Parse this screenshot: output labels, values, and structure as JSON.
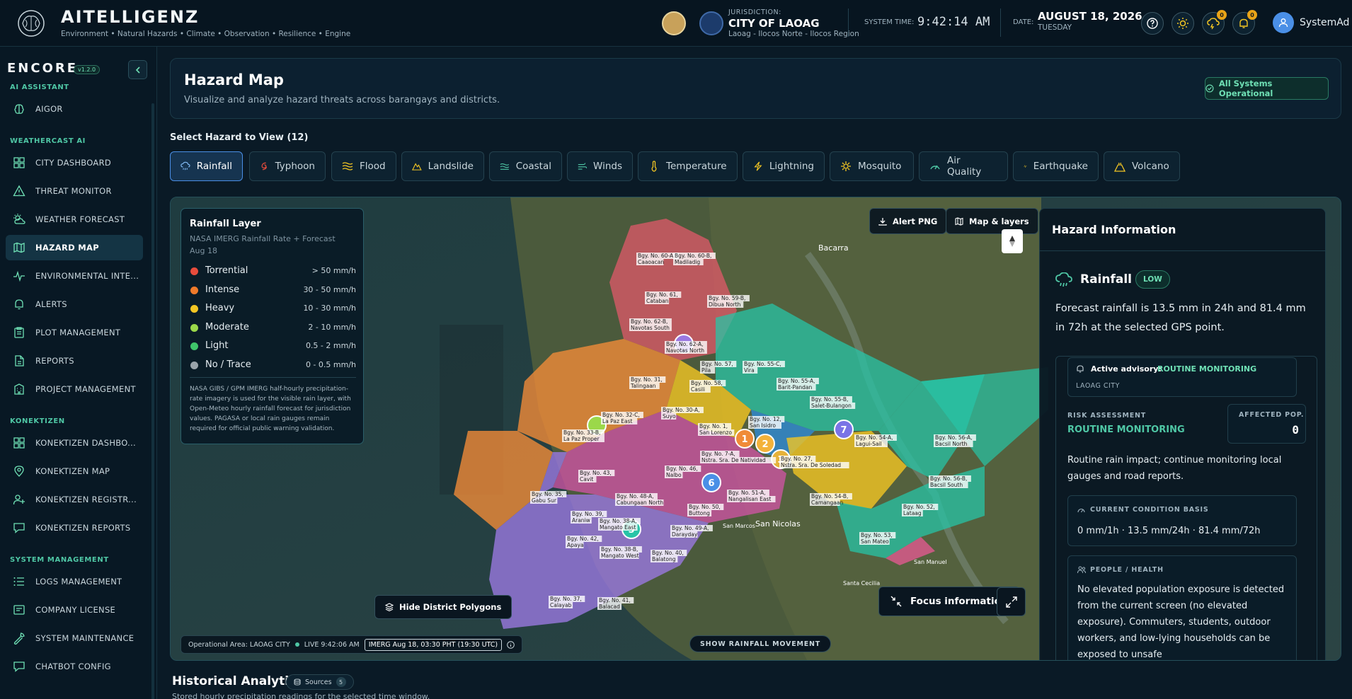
{
  "brand": {
    "name": "AITELLIGENZ",
    "subtitle": "Environment • Natural Hazards • Climate • Observation • Resilience • Engine"
  },
  "jurisdiction": {
    "label": "JURISDICTION:",
    "name": "CITY OF LAOAG",
    "region": "Laoag - Ilocos Norte - Ilocos Region"
  },
  "system_time": {
    "label": "SYSTEM TIME:",
    "value": "9:42:14 AM"
  },
  "date": {
    "label": "DATE:",
    "value": "AUGUST 18, 2026",
    "day": "TUESDAY"
  },
  "header_badges": {
    "weather_count": "0",
    "alerts_count": "0"
  },
  "user": {
    "name": "SystemAd"
  },
  "sidebar": {
    "logo": "ENCORE",
    "version": "v1.2.0",
    "sections": [
      {
        "title": "AI ASSISTANT",
        "items": [
          {
            "label": "AIGOR",
            "icon": "brain-icon"
          }
        ]
      },
      {
        "title": "WEATHERCAST AI",
        "items": [
          {
            "label": "CITY DASHBOARD",
            "icon": "dashboard-icon"
          },
          {
            "label": "THREAT MONITOR",
            "icon": "warning-icon"
          },
          {
            "label": "WEATHER FORECAST",
            "icon": "sun-cloud-icon"
          },
          {
            "label": "HAZARD MAP",
            "icon": "map-icon",
            "active": true
          },
          {
            "label": "ENVIRONMENTAL INTE...",
            "icon": "pulse-icon"
          },
          {
            "label": "ALERTS",
            "icon": "bell-icon"
          },
          {
            "label": "PLOT MANAGEMENT",
            "icon": "clipboard-icon"
          },
          {
            "label": "REPORTS",
            "icon": "report-icon"
          },
          {
            "label": "PROJECT MANAGEMENT",
            "icon": "building-icon"
          }
        ]
      },
      {
        "title": "KONEKTIZEN",
        "items": [
          {
            "label": "KONEKTIZEN DASHBO...",
            "icon": "dashboard-icon"
          },
          {
            "label": "KONEKTIZEN MAP",
            "icon": "location-user-icon"
          },
          {
            "label": "KONEKTIZEN REGISTR...",
            "icon": "user-plus-icon"
          },
          {
            "label": "KONEKTIZEN REPORTS",
            "icon": "chat-icon"
          }
        ]
      },
      {
        "title": "SYSTEM MANAGEMENT",
        "items": [
          {
            "label": "LOGS MANAGEMENT",
            "icon": "list-icon"
          },
          {
            "label": "COMPANY LICENSE",
            "icon": "license-icon"
          },
          {
            "label": "SYSTEM MAINTENANCE",
            "icon": "wrench-icon"
          },
          {
            "label": "CHATBOT CONFIG",
            "icon": "chat-icon"
          }
        ]
      }
    ]
  },
  "page": {
    "title": "Hazard Map",
    "subtitle": "Visualize and analyze hazard threats across barangays and districts.",
    "status": "All Systems Operational"
  },
  "hazards": {
    "title": "Select Hazard to View (12)",
    "tabs": [
      {
        "label": "Rainfall",
        "icon": "rain-icon",
        "active": true
      },
      {
        "label": "Typhoon",
        "icon": "typhoon-icon"
      },
      {
        "label": "Flood",
        "icon": "waves-icon"
      },
      {
        "label": "Landslide",
        "icon": "mountain-icon"
      },
      {
        "label": "Coastal",
        "icon": "coastal-icon"
      },
      {
        "label": "Winds",
        "icon": "wind-icon"
      },
      {
        "label": "Temperature",
        "icon": "thermometer-icon"
      },
      {
        "label": "Lightning",
        "icon": "lightning-icon"
      },
      {
        "label": "Mosquito",
        "icon": "mosquito-icon"
      },
      {
        "label": "Air Quality",
        "icon": "gauge-icon"
      },
      {
        "label": "Earthquake",
        "icon": "seismic-icon"
      },
      {
        "label": "Volcano",
        "icon": "volcano-icon"
      }
    ]
  },
  "legend": {
    "title": "Rainfall Layer",
    "subtitle": "NASA IMERG Rainfall Rate + Forecast",
    "date": "Aug 18",
    "rows": [
      {
        "name": "Torrential",
        "range": "> 50 mm/h",
        "color": "#e74c3c"
      },
      {
        "name": "Intense",
        "range": "30 - 50 mm/h",
        "color": "#f07a2a"
      },
      {
        "name": "Heavy",
        "range": "10 - 30 mm/h",
        "color": "#f3c623"
      },
      {
        "name": "Moderate",
        "range": "2 - 10 mm/h",
        "color": "#9bd84a"
      },
      {
        "name": "Light",
        "range": "0.5 - 2 mm/h",
        "color": "#3fc56a"
      },
      {
        "name": "No / Trace",
        "range": "0 - 0.5 mm/h",
        "color": "#9aa4ab"
      }
    ],
    "note": "NASA GIBS / GPM IMERG half-hourly precipitation-rate imagery is used for the visible rain layer, with Open-Meteo hourly rainfall forecast for jurisdiction values. PAGASA or local rain gauges remain required for official public warning validation."
  },
  "map": {
    "alert_png": "Alert PNG",
    "layers": "Map & layers",
    "hide_polygons": "Hide District Polygons",
    "focus": "Focus information",
    "show_movement": "SHOW RAINFALL MOVEMENT",
    "operational_area": "Operational Area: LAOAG CITY",
    "live": "LIVE 9:42:06 AM",
    "imerg": "IMERG Aug 18, 03:30 PHT (19:30 UTC)",
    "place_labels": [
      "Bacarra",
      "San Nicolas",
      "San Manuel",
      "Santa Cecilia",
      "San Marcos"
    ],
    "barangays": [
      "Bgy. No. 60-A, Caaoacan",
      "Bgy. No. 60-B, Madiladig",
      "Bgy. No. 61, Cataban",
      "Bgy. No. 59-B, Dibua North",
      "Bgy. No. 62-B, Navotas South",
      "Bgy. No. 62-A, Navotas North",
      "Bgy. No. 57, Pila",
      "Bgy. No. 55-C, Vira",
      "Bgy. No. 55-A, Barit-Pandan",
      "Bgy. No. 31, Talingaan",
      "Bgy. No. 58, Casili",
      "Bgy. No. 55-B, Salet-Bulangon",
      "Bgy. No. 30-A, Suyo",
      "Bgy. No. 32-C, La Paz East",
      "Bgy. No. 33-B, La Paz Proper",
      "Bgy. No. 1, San Lorenzo",
      "Bgy. No. 12, San Isidro",
      "Bgy. No. 54-A, Lagui-Sail",
      "Bgy. No. 56-A, Bacsil North",
      "Bgy. No. 7-A, Nstra. Sra. De Natividad",
      "Bgy. No. 27, Nstra. Sra. De Soledad",
      "Bgy. No. 43, Cavit",
      "Bgy. No. 46, Nalbo",
      "Bgy. No. 56-B, Bacsil South",
      "Bgy. No. 35, Gabu Sur",
      "Bgy. No. 48-A, Cabungaan North",
      "Bgy. No. 51-A, Nangalisan East",
      "Bgy. No. 54-B, Camangaan",
      "Bgy. No. 39, Araniw",
      "Bgy. No. 50, Buttong",
      "Bgy. No. 52, Lataag",
      "Bgy. No. 38-A, Mangato East",
      "Bgy. No. 49-A, Darayday",
      "Bgy. No. 53, San Mateo",
      "Bgy. No. 42, Apaya",
      "Bgy. No. 38-B, Mangato West",
      "Bgy. No. 40, Balatong",
      "Bgy. No. 37, Calayab",
      "Bgy. No. 41, Balacad"
    ]
  },
  "info": {
    "title": "Hazard Information",
    "hazard": "Rainfall",
    "level": "LOW",
    "forecast": "Forecast rainfall is 13.5 mm in 24h and 81.4 mm in 72h at the selected GPS point.",
    "advisory_label": "Active advisory:",
    "advisory_value": "ROUTINE MONITORING",
    "city": "LAOAG CITY",
    "risk_label": "RISK ASSESSMENT",
    "risk_value": "ROUTINE MONITORING",
    "affected_label": "AFFECTED POP.",
    "affected_value": "0",
    "impact": "Routine rain impact; continue monitoring local gauges and road reports.",
    "condition_label": "CURRENT CONDITION BASIS",
    "condition_value": "0 mm/1h · 13.5 mm/24h · 81.4 mm/72h",
    "people_label": "PEOPLE / HEALTH",
    "people_text": "No elevated population exposure is detected from the current screen (no elevated exposure). Commuters, students, outdoor workers, and low-lying households can be exposed to unsafe"
  },
  "historical": {
    "title": "Historical Analytics",
    "sources_label": "Sources",
    "sources_count": "5",
    "subtitle": "Stored hourly precipitation readings for the selected time window."
  }
}
